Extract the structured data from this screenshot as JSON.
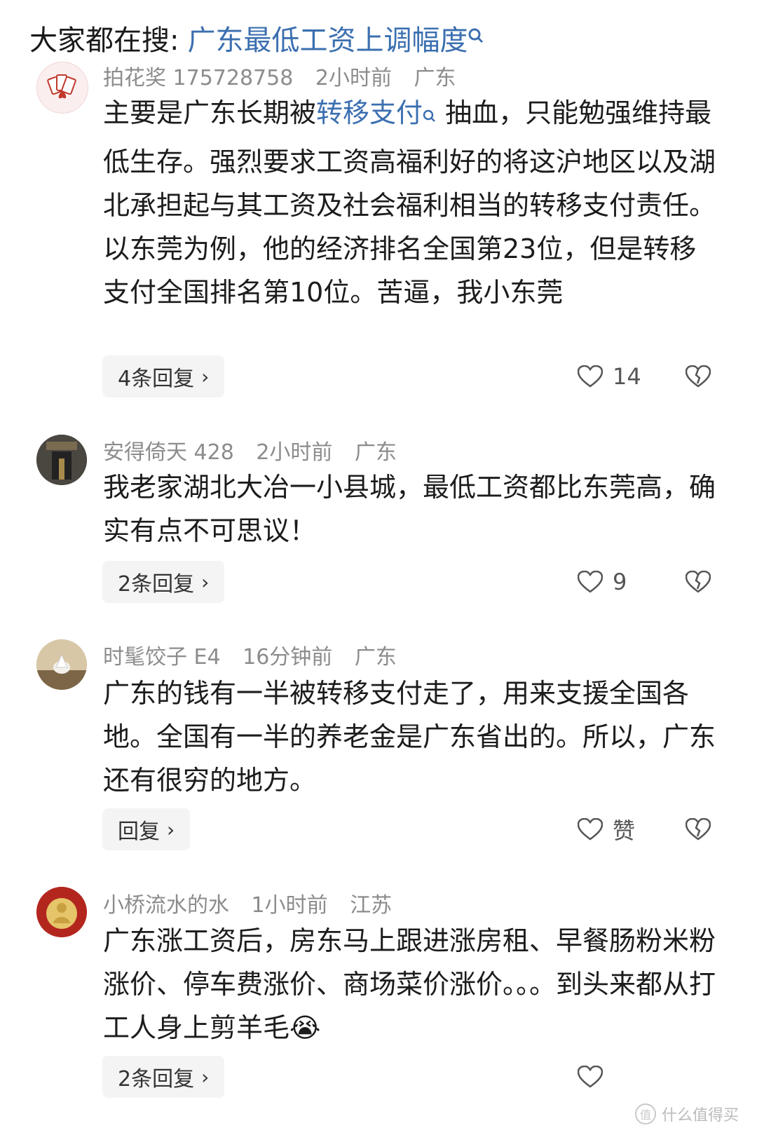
{
  "search": {
    "prefix": "大家都在搜:",
    "query": "广东最低工资上调幅度"
  },
  "comments": [
    {
      "username": "拍花奖 175728758",
      "time": "2小时前",
      "location": "广东",
      "text_before": "主要是广东长期被",
      "keyword": "转移支付",
      "text_after": " 抽血，只能勉强维持最低生存。强烈要求工资高福利好的将这沪地区以及湖北承担起与其工资及社会福利相当的转移支付责任。 以东莞为例，他的经济排名全国第23位，但是转移支付全国排名第10位。苦逼，我小东莞",
      "replies": "4条回复",
      "likes": "14"
    },
    {
      "username": "安得倚天 428",
      "time": "2小时前",
      "location": "广东",
      "text": "我老家湖北大冶一小县城，最低工资都比东莞高，确实有点不可思议！",
      "replies": "2条回复",
      "likes": "9"
    },
    {
      "username": "时髦饺子 E4",
      "time": "16分钟前",
      "location": "广东",
      "text": "广东的钱有一半被转移支付走了，用来支援全国各地。全国有一半的养老金是广东省出的。所以，广东还有很穷的地方。",
      "replies": "回复",
      "likes": "赞"
    },
    {
      "username": "小桥流水的水",
      "time": "1小时前",
      "location": "江苏",
      "text": "广东涨工资后，房东马上跟进涨房租、早餐肠粉米粉涨价、停车费涨价、商场菜价涨价。。。到头来都从打工人身上剪羊毛",
      "emoji": "😭",
      "replies": "2条回复",
      "likes": ""
    }
  ],
  "watermark": "什么值得买",
  "colors": {
    "link": "#3b6fb0",
    "meta": "#8c8c8c",
    "reply_bg": "#f4f4f4"
  }
}
